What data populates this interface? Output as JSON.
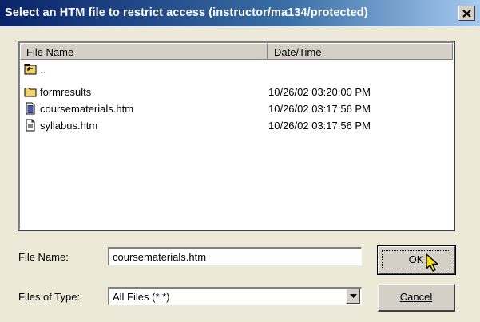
{
  "window": {
    "title": "Select an HTM file to restrict access (instructor/ma134/protected)",
    "close_icon": "close-icon"
  },
  "file_list": {
    "columns": [
      "File Name",
      "Date/Time"
    ],
    "rows": [
      {
        "icon": "parent-folder-icon",
        "name": "..",
        "date": ""
      },
      {
        "icon": "folder-icon",
        "name": "formresults",
        "date": "10/26/02 03:20:00 PM"
      },
      {
        "icon": "html-document-icon",
        "name": "coursematerials.htm",
        "date": "10/26/02 03:17:56 PM"
      },
      {
        "icon": "document-icon",
        "name": "syllabus.htm",
        "date": "10/26/02 03:17:56 PM"
      }
    ]
  },
  "form": {
    "file_name_label": "File Name:",
    "file_name_value": "coursematerials.htm",
    "file_type_label": "Files of Type:",
    "file_type_value": "All Files (*.*)"
  },
  "buttons": {
    "ok_label": "OK",
    "cancel_label": "Cancel"
  },
  "colors": {
    "title_bar_start": "#0a246a",
    "title_bar_end": "#a6caf0",
    "dialog_background": "#ece9d8",
    "button_face": "#d4d0c8",
    "folder_yellow": "#f2d36b",
    "cursor_yellow": "#f5e000"
  }
}
